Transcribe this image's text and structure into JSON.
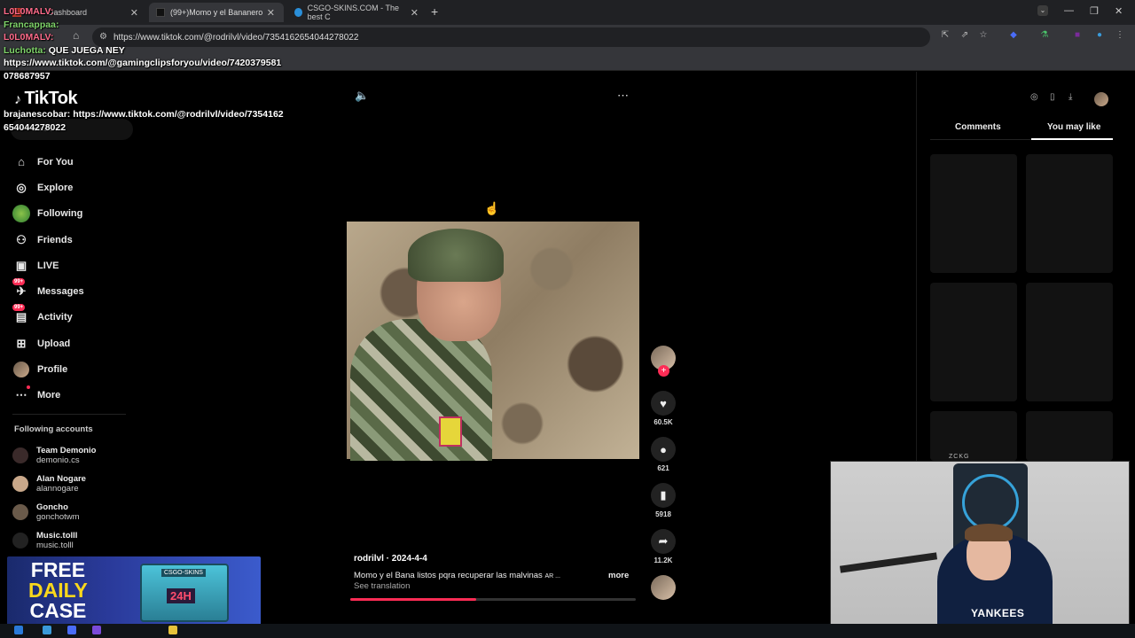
{
  "browser": {
    "tabs": [
      {
        "title": "Dashboard",
        "active": false
      },
      {
        "title": "(99+)Momo y el Bananero",
        "active": true
      },
      {
        "title": "CSGO-SKINS.COM - The best C",
        "active": false
      }
    ],
    "url": "https://www.tiktok.com/@rodrilvl/video/7354162654044278022"
  },
  "chat": [
    {
      "user": "L0L0MALV:",
      "msg": "",
      "color": "user-r"
    },
    {
      "user": "Francappaa:",
      "msg": "",
      "color": "user-g"
    },
    {
      "user": "L0L0MALV:",
      "msg": "",
      "color": "user-r"
    },
    {
      "user": "Luchotta:",
      "msg": "QUE JUEGA NEY",
      "color": "user-g"
    },
    {
      "user": "",
      "msg": "https://www.tiktok.com/@gamingclipsforyou/video/7420379581",
      "color": "user-w"
    },
    {
      "user": "",
      "msg": "078687957",
      "color": "user-w"
    },
    {
      "user": "",
      "msg": "",
      "color": "user-w"
    },
    {
      "user": "",
      "msg": "",
      "color": "user-w"
    },
    {
      "user": "brajanescobar:",
      "msg": "https://www.tiktok.com/@rodrilvl/video/7354162",
      "color": "user-w"
    },
    {
      "user": "",
      "msg": "654044278022",
      "color": "user-w"
    }
  ],
  "tiktok": {
    "logo": "TikTok",
    "search_placeholder": "Search",
    "nav": [
      {
        "label": "For You",
        "icon": "home-icon",
        "glyph": "⌂",
        "badge": ""
      },
      {
        "label": "Explore",
        "icon": "compass-icon",
        "glyph": "◎",
        "badge": ""
      },
      {
        "label": "Following",
        "icon": "following-avatar-icon",
        "glyph": "",
        "badge": ""
      },
      {
        "label": "Friends",
        "icon": "friends-icon",
        "glyph": "⚇",
        "badge": ""
      },
      {
        "label": "LIVE",
        "icon": "live-icon",
        "glyph": "▣",
        "badge": ""
      },
      {
        "label": "Messages",
        "icon": "messages-icon",
        "glyph": "✈",
        "badge": "99+"
      },
      {
        "label": "Activity",
        "icon": "activity-icon",
        "glyph": "▤",
        "badge": "99+"
      },
      {
        "label": "Upload",
        "icon": "upload-icon",
        "glyph": "⊞",
        "badge": ""
      },
      {
        "label": "Profile",
        "icon": "profile-avatar-icon",
        "glyph": "",
        "badge": ""
      },
      {
        "label": "More",
        "icon": "more-icon",
        "glyph": "⋯",
        "badge": ""
      }
    ],
    "following_title": "Following accounts",
    "following": [
      {
        "name": "Team Demonio",
        "handle": "demonio.cs",
        "color": "#3a2a2a"
      },
      {
        "name": "Alan Nogare",
        "handle": "alannogare",
        "color": "#c9a88a"
      },
      {
        "name": "Goncho",
        "handle": "gonchotwm",
        "color": "#6a5a4a"
      },
      {
        "name": "Music.tolll",
        "handle": "music.tolll",
        "color": "#222222"
      }
    ],
    "video": {
      "author": "rodrilvl",
      "date": "2024-4-4",
      "author_line": "rodrilvl · 2024-4-4",
      "description": "Momo y el Bana listos pqra recuperar las malvinas",
      "desc_tag": "AR ...",
      "more": "more",
      "see_translation": "See translation",
      "progress": 0.44
    },
    "actions": {
      "likes": "60.5K",
      "comments": "621",
      "saves": "5918",
      "shares": "11.2K"
    },
    "right_panel": {
      "tabs": [
        "Comments",
        "You may like"
      ],
      "active_tab": "You may like"
    }
  },
  "ad": {
    "line1": "FREE",
    "line2": "DAILY",
    "line3": "CASE",
    "case_label": "24H",
    "case_brand": "CSGO-SKINS"
  },
  "webcam": {
    "tag": "ZCKG",
    "shirt": "YANKEES"
  }
}
